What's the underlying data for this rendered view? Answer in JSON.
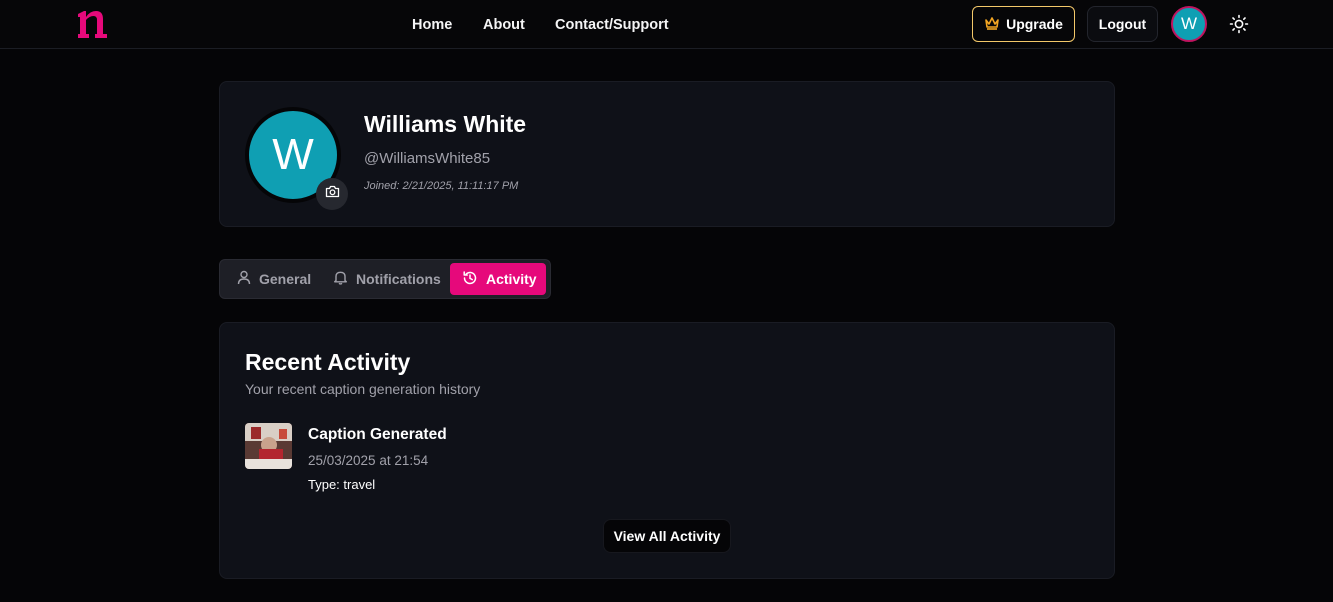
{
  "colors": {
    "accent": "#e6097b",
    "avatar_bg": "#0f9fb3",
    "upgrade_border": "#f3c86a",
    "background": "#050507",
    "card_bg": "#0f1118"
  },
  "nav": {
    "logo_icon": "n-logo-icon",
    "links": [
      "Home",
      "About",
      "Contact/Support"
    ],
    "upgrade_label": "Upgrade",
    "upgrade_icon": "crown-icon",
    "logout_label": "Logout",
    "avatar_initial": "W",
    "theme_icon": "sun-icon"
  },
  "profile": {
    "initial": "W",
    "name": "Williams White",
    "handle": "@WilliamsWhite85",
    "joined": "Joined: 2/21/2025, 11:11:17 PM",
    "camera_icon": "camera-icon"
  },
  "tabs": [
    {
      "label": "General",
      "icon": "user-icon",
      "active": false
    },
    {
      "label": "Notifications",
      "icon": "bell-icon",
      "active": false
    },
    {
      "label": "Activity",
      "icon": "history-icon",
      "active": true
    }
  ],
  "activity": {
    "title": "Recent Activity",
    "subtitle": "Your recent caption generation history",
    "items": [
      {
        "title": "Caption Generated",
        "date": "25/03/2025 at 21:54",
        "type": "Type: travel"
      }
    ],
    "view_all_label": "View All Activity"
  }
}
